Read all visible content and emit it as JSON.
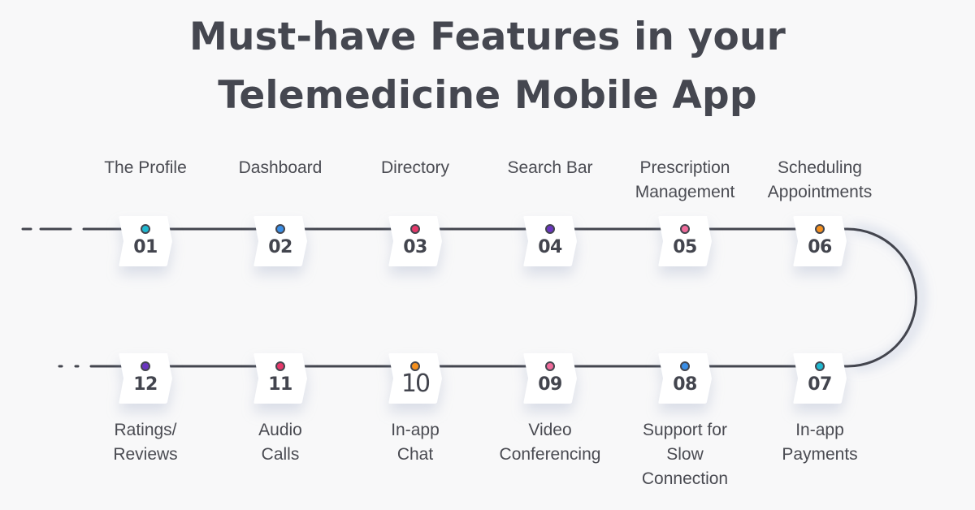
{
  "title": {
    "line1": "Must-have Features in your",
    "line2": "Telemedicine Mobile App"
  },
  "colors": {
    "line": "#43454e",
    "teal": "#1fb8d0",
    "blue": "#3a8ee6",
    "red": "#e6386a",
    "purple": "#6a35c0",
    "pink": "#f06a9a",
    "orange": "#f5901e"
  },
  "top_row": [
    {
      "number": "01",
      "label": "The Profile",
      "dot_color": "#1fb8d0"
    },
    {
      "number": "02",
      "label": "Dashboard",
      "dot_color": "#3a8ee6"
    },
    {
      "number": "03",
      "label": "Directory",
      "dot_color": "#e6386a"
    },
    {
      "number": "04",
      "label": "Search Bar",
      "dot_color": "#6a35c0"
    },
    {
      "number": "05",
      "label": "Prescription\nManagement",
      "dot_color": "#f06a9a"
    },
    {
      "number": "06",
      "label": "Scheduling\nAppointments",
      "dot_color": "#f5901e"
    }
  ],
  "bottom_row": [
    {
      "number": "12",
      "label": "Ratings/\nReviews",
      "dot_color": "#6a35c0"
    },
    {
      "number": "11",
      "label": "Audio\nCalls",
      "dot_color": "#e6386a"
    },
    {
      "number": "10",
      "label": "In-app\nChat",
      "dot_color": "#f5901e"
    },
    {
      "number": "09",
      "label": "Video\nConferencing",
      "dot_color": "#f06a9a"
    },
    {
      "number": "08",
      "label": "Support for\nSlow\nConnection",
      "dot_color": "#3a8ee6"
    },
    {
      "number": "07",
      "label": "In-app\nPayments",
      "dot_color": "#1fb8d0"
    }
  ]
}
